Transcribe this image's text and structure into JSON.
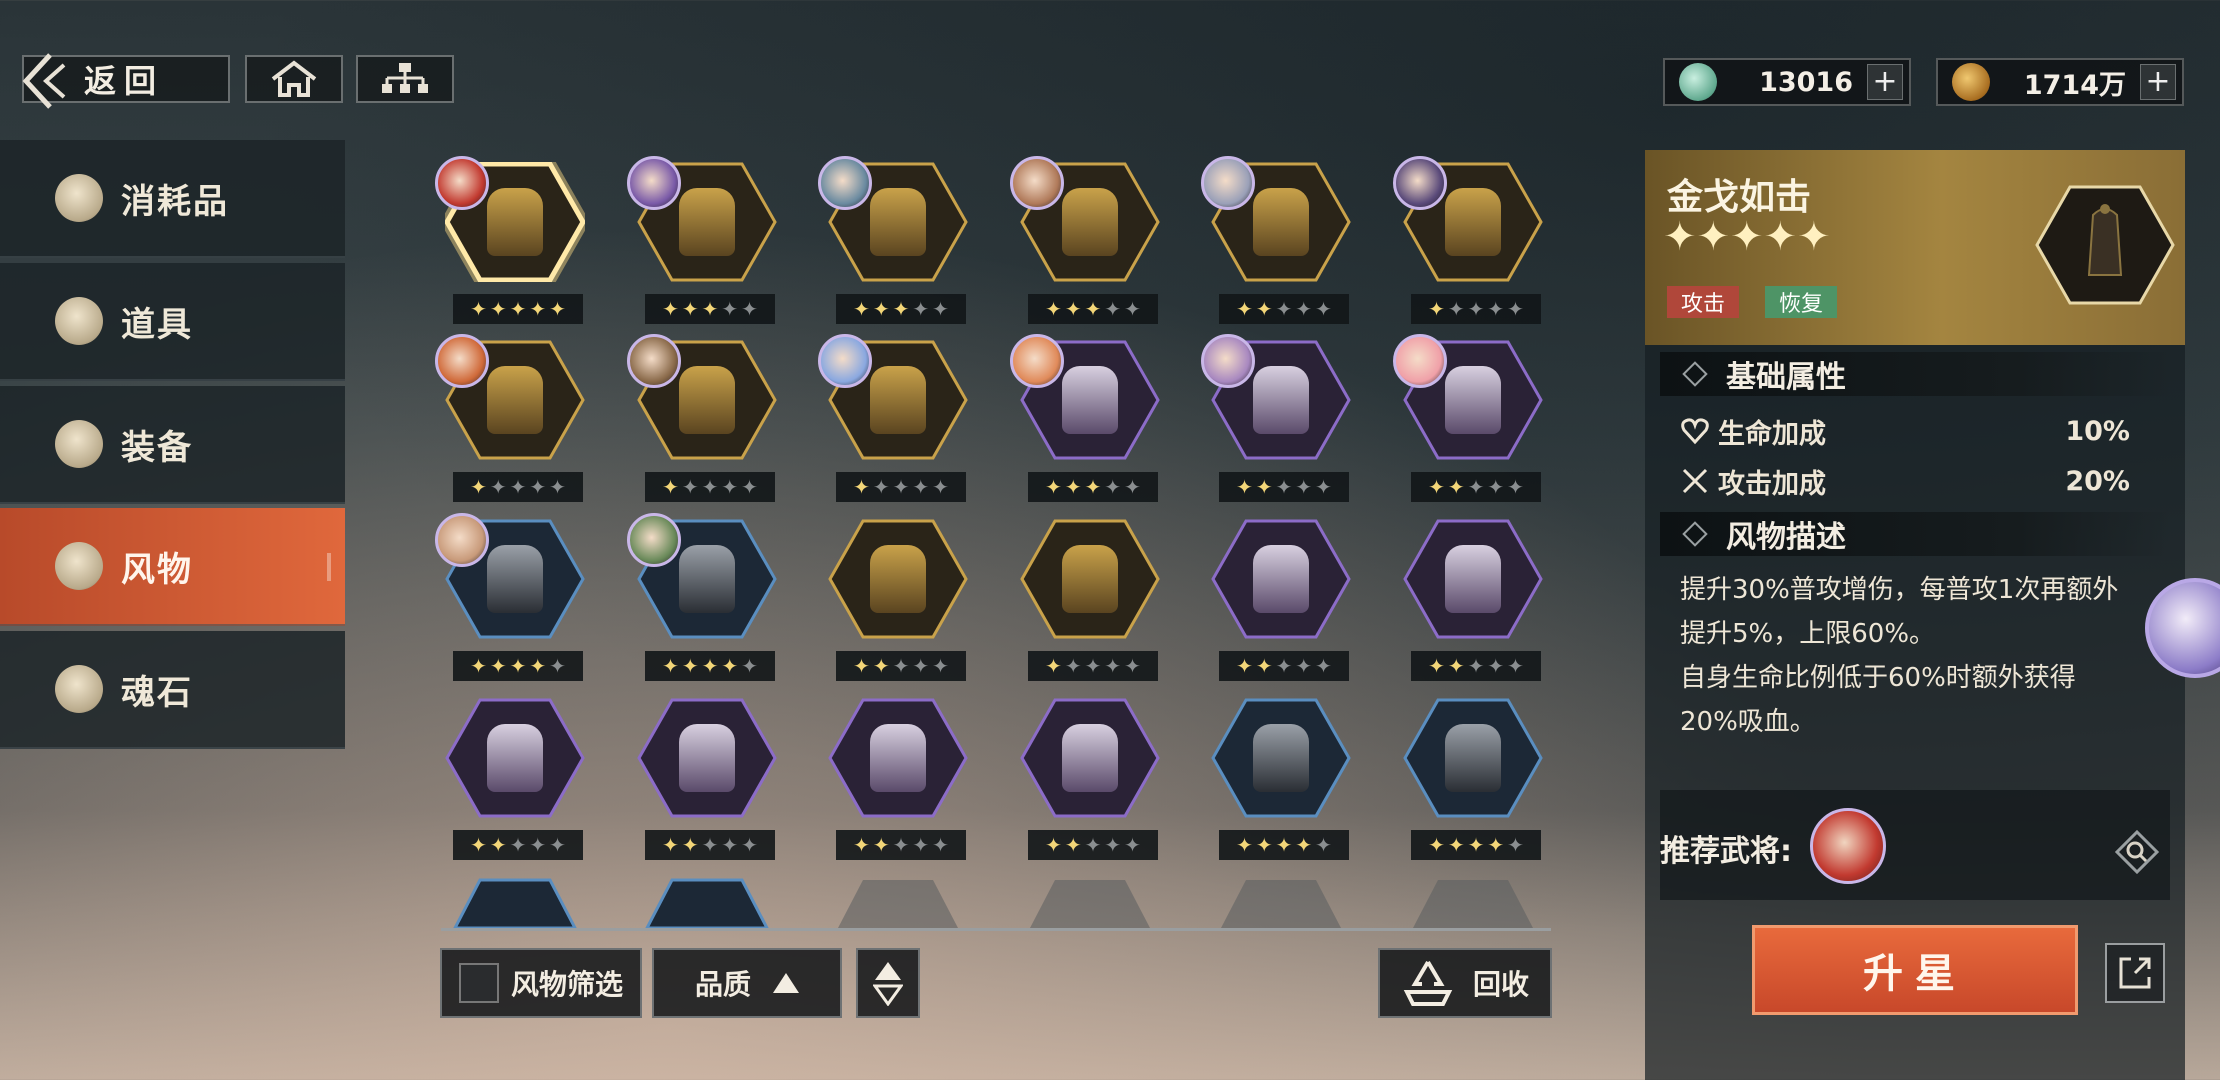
{
  "topbar": {
    "back_label": "返回",
    "currencies": [
      {
        "name": "jade",
        "amount": "13016"
      },
      {
        "name": "coin",
        "amount": "1714万"
      }
    ]
  },
  "sidebar": {
    "items": [
      {
        "label": "消耗品",
        "active": false
      },
      {
        "label": "道具",
        "active": false
      },
      {
        "label": "装备",
        "active": false
      },
      {
        "label": "风物",
        "active": true
      },
      {
        "label": "魂石",
        "active": false
      }
    ]
  },
  "grid": {
    "items": [
      {
        "stars": 5,
        "rarity": "gold",
        "selected": true,
        "portrait": "#c23a30"
      },
      {
        "stars": 3,
        "rarity": "gold",
        "portrait": "#7a5aa8"
      },
      {
        "stars": 3,
        "rarity": "gold",
        "portrait": "#6a8aa0"
      },
      {
        "stars": 3,
        "rarity": "gold",
        "portrait": "#b07a5a"
      },
      {
        "stars": 2,
        "rarity": "gold",
        "portrait": "#9aa0b8"
      },
      {
        "stars": 1,
        "rarity": "gold",
        "portrait": "#5a4a7a"
      },
      {
        "stars": 1,
        "rarity": "gold",
        "portrait": "#d06a3a"
      },
      {
        "stars": 1,
        "rarity": "gold",
        "portrait": "#8a6a4a"
      },
      {
        "stars": 1,
        "rarity": "gold",
        "portrait": "#8aa8e0"
      },
      {
        "stars": 3,
        "rarity": "purple",
        "portrait": "#e08a5a"
      },
      {
        "stars": 2,
        "rarity": "purple",
        "portrait": "#a888c0"
      },
      {
        "stars": 2,
        "rarity": "purple",
        "portrait": "#f0a0a8"
      },
      {
        "stars": 4,
        "rarity": "blue",
        "portrait": "#c89a7a"
      },
      {
        "stars": 4,
        "rarity": "blue",
        "portrait": "#6a8a5a"
      },
      {
        "stars": 2,
        "rarity": "gold"
      },
      {
        "stars": 1,
        "rarity": "gold"
      },
      {
        "stars": 2,
        "rarity": "purple"
      },
      {
        "stars": 2,
        "rarity": "purple"
      },
      {
        "stars": 2,
        "rarity": "purple"
      },
      {
        "stars": 2,
        "rarity": "purple"
      },
      {
        "stars": 2,
        "rarity": "purple"
      },
      {
        "stars": 2,
        "rarity": "purple"
      },
      {
        "stars": 4,
        "rarity": "blue"
      },
      {
        "stars": 4,
        "rarity": "blue"
      }
    ],
    "partial_row": [
      "blue",
      "blue",
      "grey",
      "grey",
      "grey",
      "grey"
    ]
  },
  "bottom": {
    "filter_label": "风物筛选",
    "sort_label": "品质",
    "recycle_label": "回收"
  },
  "detail": {
    "name": "金戈如击",
    "stars": "✦✦✦✦✦",
    "tags": [
      "攻击",
      "恢复"
    ],
    "base_title": "基础属性",
    "stats": [
      {
        "name": "生命加成",
        "value": "10%"
      },
      {
        "name": "攻击加成",
        "value": "20%"
      }
    ],
    "desc_title": "风物描述",
    "description": "提升30%普攻增伤，每普攻1次再额外\n提升5%，上限60%。\n自身生命比例低于60%时额外获得\n20%吸血。",
    "recommend_label": "推荐武将:",
    "upstar_label": "升星"
  },
  "colors": {
    "accent_orange": "#e0683c",
    "star_on": "#f3d678",
    "star_off": "#8a8e90",
    "hex_gold": "#c9a24a",
    "hex_purple": "#8c6cc8",
    "hex_blue": "#5a8ec0"
  }
}
